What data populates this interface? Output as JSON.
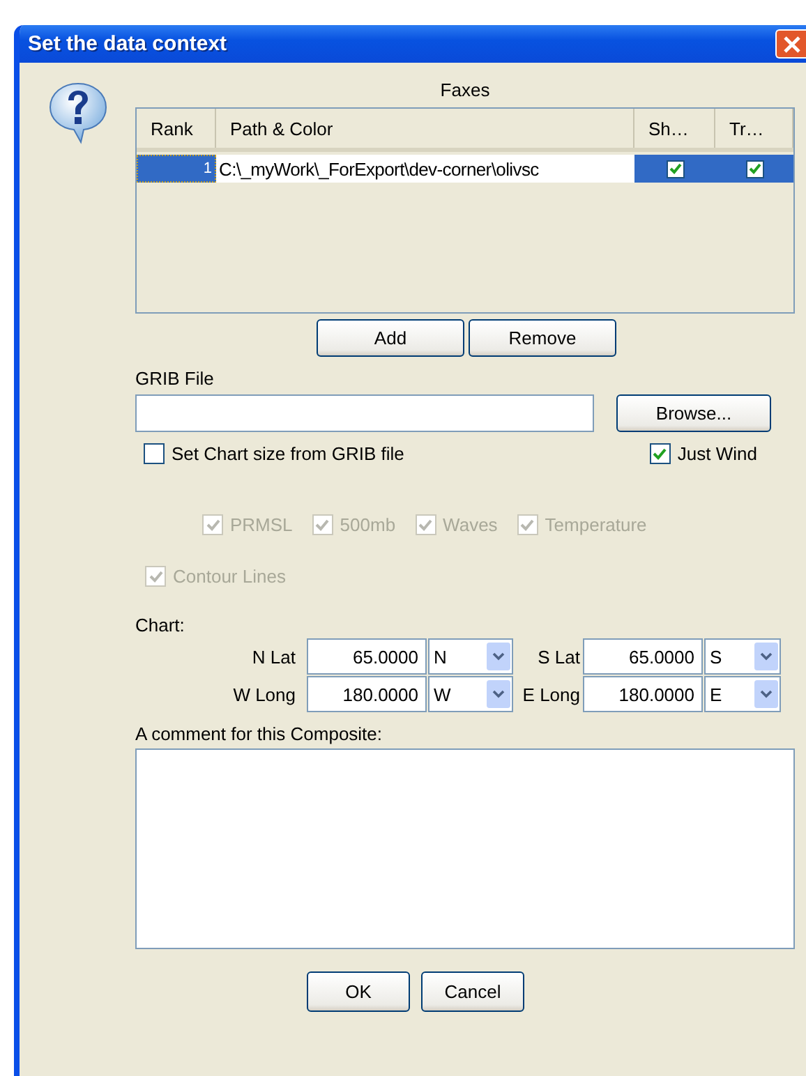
{
  "window": {
    "title": "Set the data context"
  },
  "faxes": {
    "title": "Faxes",
    "columns": [
      "Rank",
      "Path & Color",
      "Sh…",
      "Tr…"
    ],
    "rows": [
      {
        "rank": "1",
        "path": "C:\\_myWork\\_ForExport\\dev-corner\\olivsc",
        "show": true,
        "transparent": true,
        "selected": true
      }
    ]
  },
  "table_buttons": [
    "Add",
    "Remove"
  ],
  "grib": {
    "label": "GRIB File",
    "browse": "Browse..."
  },
  "options": [
    {
      "label": "Set Chart size from GRIB file",
      "checked": false,
      "disabled": false
    },
    {
      "label": "Just Wind",
      "checked": true,
      "disabled": false
    }
  ],
  "layers": [
    {
      "label": "PRMSL",
      "checked": true,
      "disabled": true
    },
    {
      "label": "500mb",
      "checked": true,
      "disabled": true
    },
    {
      "label": "Waves",
      "checked": true,
      "disabled": true
    },
    {
      "label": "Temperature",
      "checked": true,
      "disabled": true
    }
  ],
  "contour": {
    "label": "Contour Lines",
    "checked": true,
    "disabled": true
  },
  "chart": {
    "label": "Chart:",
    "fields": [
      {
        "label": "N Lat",
        "value": "65.0000",
        "hemisphere": "N"
      },
      {
        "label": "S Lat",
        "value": "65.0000",
        "hemisphere": "S"
      },
      {
        "label": "W Long",
        "value": "180.0000",
        "hemisphere": "W"
      },
      {
        "label": "E Long",
        "value": "180.0000",
        "hemisphere": "E"
      }
    ]
  },
  "comment": {
    "label": "A comment for this Composite:"
  },
  "buttons": [
    "OK",
    "Cancel"
  ]
}
